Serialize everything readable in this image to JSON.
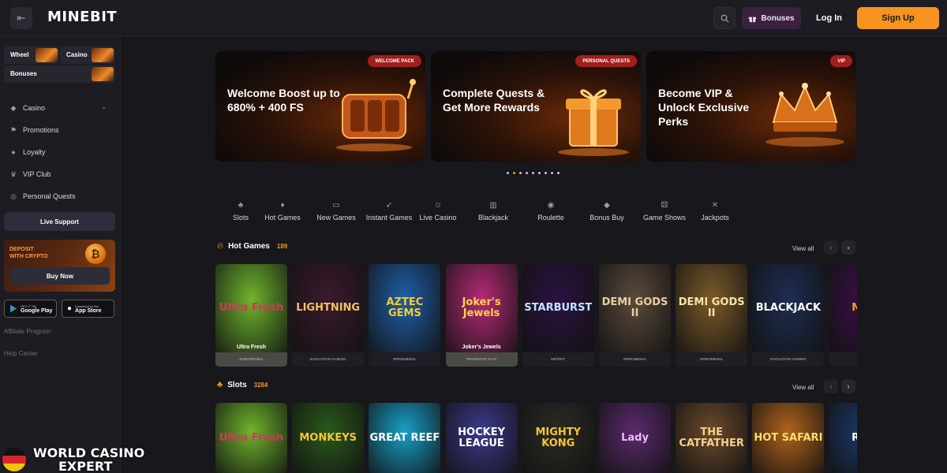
{
  "brand": {
    "logo": "MINEBIT"
  },
  "header": {
    "bonuses_label": "Bonuses",
    "login_label": "Log In",
    "signup_label": "Sign Up"
  },
  "sidebar": {
    "shortcuts": [
      {
        "label": "Wheel"
      },
      {
        "label": "Casino"
      },
      {
        "label": "Bonuses"
      }
    ],
    "nav": [
      {
        "label": "Casino",
        "icon": "diamond-icon"
      },
      {
        "label": "Promotions",
        "icon": "flag-icon"
      },
      {
        "label": "Loyalty",
        "icon": "medal-icon"
      },
      {
        "label": "VIP Club",
        "icon": "crown-icon"
      },
      {
        "label": "Personal Quests",
        "icon": "target-icon"
      }
    ],
    "live_support": "Live Support",
    "deposit": {
      "line1": "DEPOSIT",
      "line2": "WITH CRYPTO",
      "button": "Buy Now"
    },
    "stores": [
      {
        "small": "GET IT ON",
        "big": "Google Play"
      },
      {
        "small": "Download on the",
        "big": "App Store"
      }
    ],
    "links": [
      "Affiliate Program",
      "Help Center"
    ]
  },
  "banners": [
    {
      "tag": "WELCOME PACK",
      "title": "Welcome Boost up to 680% + 400 FS"
    },
    {
      "tag": "PERSONAL QUESTS",
      "title": "Complete Quests & Get More Rewards"
    },
    {
      "tag": "VIP",
      "title": "Become VIP & Unlock Exclusive Perks"
    }
  ],
  "carousel": {
    "total": 9,
    "active": 1
  },
  "categories": [
    {
      "label": "Slots",
      "icon": "cherry-icon"
    },
    {
      "label": "Hot Games",
      "icon": "flame-icon"
    },
    {
      "label": "New Games",
      "icon": "new-badge-icon"
    },
    {
      "label": "Instant Games",
      "icon": "rocket-icon"
    },
    {
      "label": "Live Casino",
      "icon": "live-dealer-icon"
    },
    {
      "label": "Blackjack",
      "icon": "cards-icon"
    },
    {
      "label": "Roulette",
      "icon": "roulette-icon"
    },
    {
      "label": "Bonus Buy",
      "icon": "tag-icon"
    },
    {
      "label": "Game Shows",
      "icon": "dice-icon"
    },
    {
      "label": "Jackpots",
      "icon": "jackpot-icon"
    }
  ],
  "hot_games": {
    "title": "Hot Games",
    "count": "189",
    "view_all": "View all",
    "games": [
      {
        "art": "Ultra Fresh",
        "name": "Ultra Fresh",
        "provider": "ENDORPHINA",
        "bg": "#6fb52c",
        "fg": "#e32f5f"
      },
      {
        "art": "LIGHTNING",
        "name": "",
        "provider": "EVOLUTION GAMING",
        "bg": "#3a1a2c",
        "fg": "#f2c261"
      },
      {
        "art": "AZTEC GEMS",
        "name": "",
        "provider": "SPINOMENAL",
        "bg": "#1f5fa8",
        "fg": "#f7cd32"
      },
      {
        "art": "Joker's Jewels",
        "name": "Joker's Jewels",
        "provider": "PRAGMATIC PLAY",
        "bg": "#b52a77",
        "fg": "#ffd447"
      },
      {
        "art": "STARBURST",
        "name": "",
        "provider": "NETENT",
        "bg": "#2a1240",
        "fg": "#c2e4ff"
      },
      {
        "art": "DEMI GODS II",
        "name": "",
        "provider": "SPINOMENAL",
        "bg": "#5b4a3c",
        "fg": "#e6cfa0"
      },
      {
        "art": "DEMI GODS II",
        "name": "",
        "provider": "SPINOMENAL",
        "bg": "#7b5a2a",
        "fg": "#ffe2a6"
      },
      {
        "art": "BLACKJACK",
        "name": "",
        "provider": "EVOLUTION GAMING",
        "bg": "#1e2d52",
        "fg": "#ffffff"
      },
      {
        "art": "MAG",
        "name": "",
        "provider": "HA",
        "bg": "#3b1048",
        "fg": "#f5a623"
      }
    ]
  },
  "slots": {
    "title": "Slots",
    "count": "3284",
    "view_all": "View all",
    "games": [
      {
        "art": "Ultra Fresh",
        "bg": "#6fb52c",
        "fg": "#e32f5f"
      },
      {
        "art": "MONKEYS",
        "bg": "#2a5a1c",
        "fg": "#f7c531"
      },
      {
        "art": "GREAT REEF",
        "bg": "#17a0c9",
        "fg": "#ffffff"
      },
      {
        "art": "HOCKEY LEAGUE",
        "bg": "#3c3a8c",
        "fg": "#ffffff"
      },
      {
        "art": "MIGHTY KONG",
        "bg": "#2b2b25",
        "fg": "#f7c531"
      },
      {
        "art": "Lady",
        "bg": "#5a2a6c",
        "fg": "#f5b8ff"
      },
      {
        "art": "THE CATFATHER",
        "bg": "#6b4a2c",
        "fg": "#f2d28a"
      },
      {
        "art": "HOT SAFARI",
        "bg": "#b0641c",
        "fg": "#ffdc6a"
      },
      {
        "art": "ROM",
        "bg": "#1c3a6c",
        "fg": "#ffffff"
      }
    ]
  },
  "watermark": {
    "line1": "WORLD CASINO",
    "line2": "EXPERT"
  }
}
